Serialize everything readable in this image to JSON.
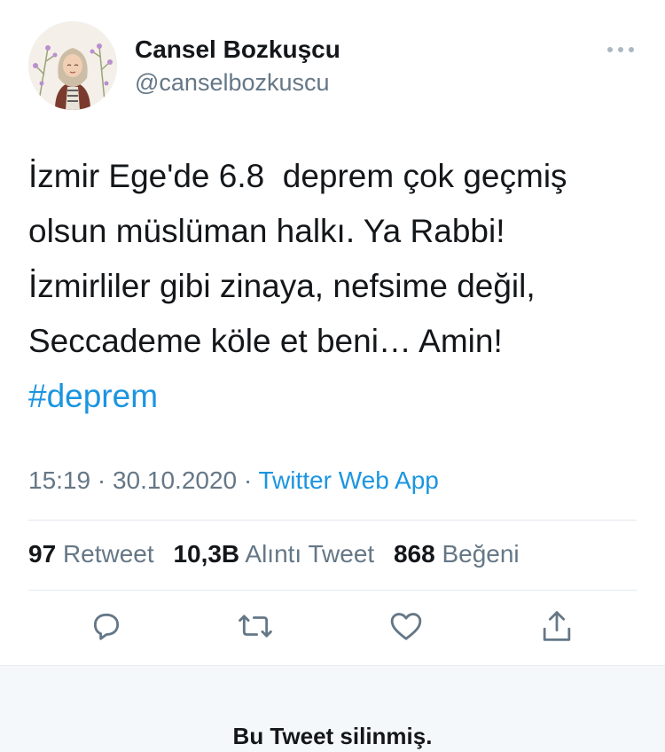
{
  "author": {
    "display_name": "Cansel Bozkuşcu",
    "handle": "@canselbozkuscu"
  },
  "tweet": {
    "lines": [
      "İzmir Ege'de 6.8  deprem çok geçmiş",
      "olsun müslüman halkı. Ya Rabbi!",
      "İzmirliler gibi zinaya, nefsime değil,",
      "Seccademe köle et beni… Amin!"
    ],
    "hashtag": "#deprem",
    "time": "15:19",
    "date": "30.10.2020",
    "separator": "·",
    "source": "Twitter Web App"
  },
  "stats": {
    "retweets_count": "97",
    "retweets_label": "Retweet",
    "quotes_count": "10,3B",
    "quotes_label": "Alıntı Tweet",
    "likes_count": "868",
    "likes_label": "Beğeni"
  },
  "actions": {
    "icons": [
      "reply-icon",
      "retweet-icon",
      "like-icon",
      "share-icon"
    ]
  },
  "deleted_notice": {
    "text": "Bu Tweet silinmiş."
  },
  "colors": {
    "link": "#1b95e0",
    "secondary_text": "#657786",
    "divider": "#e1e8ed",
    "footer_bg": "#f5f8fa"
  }
}
